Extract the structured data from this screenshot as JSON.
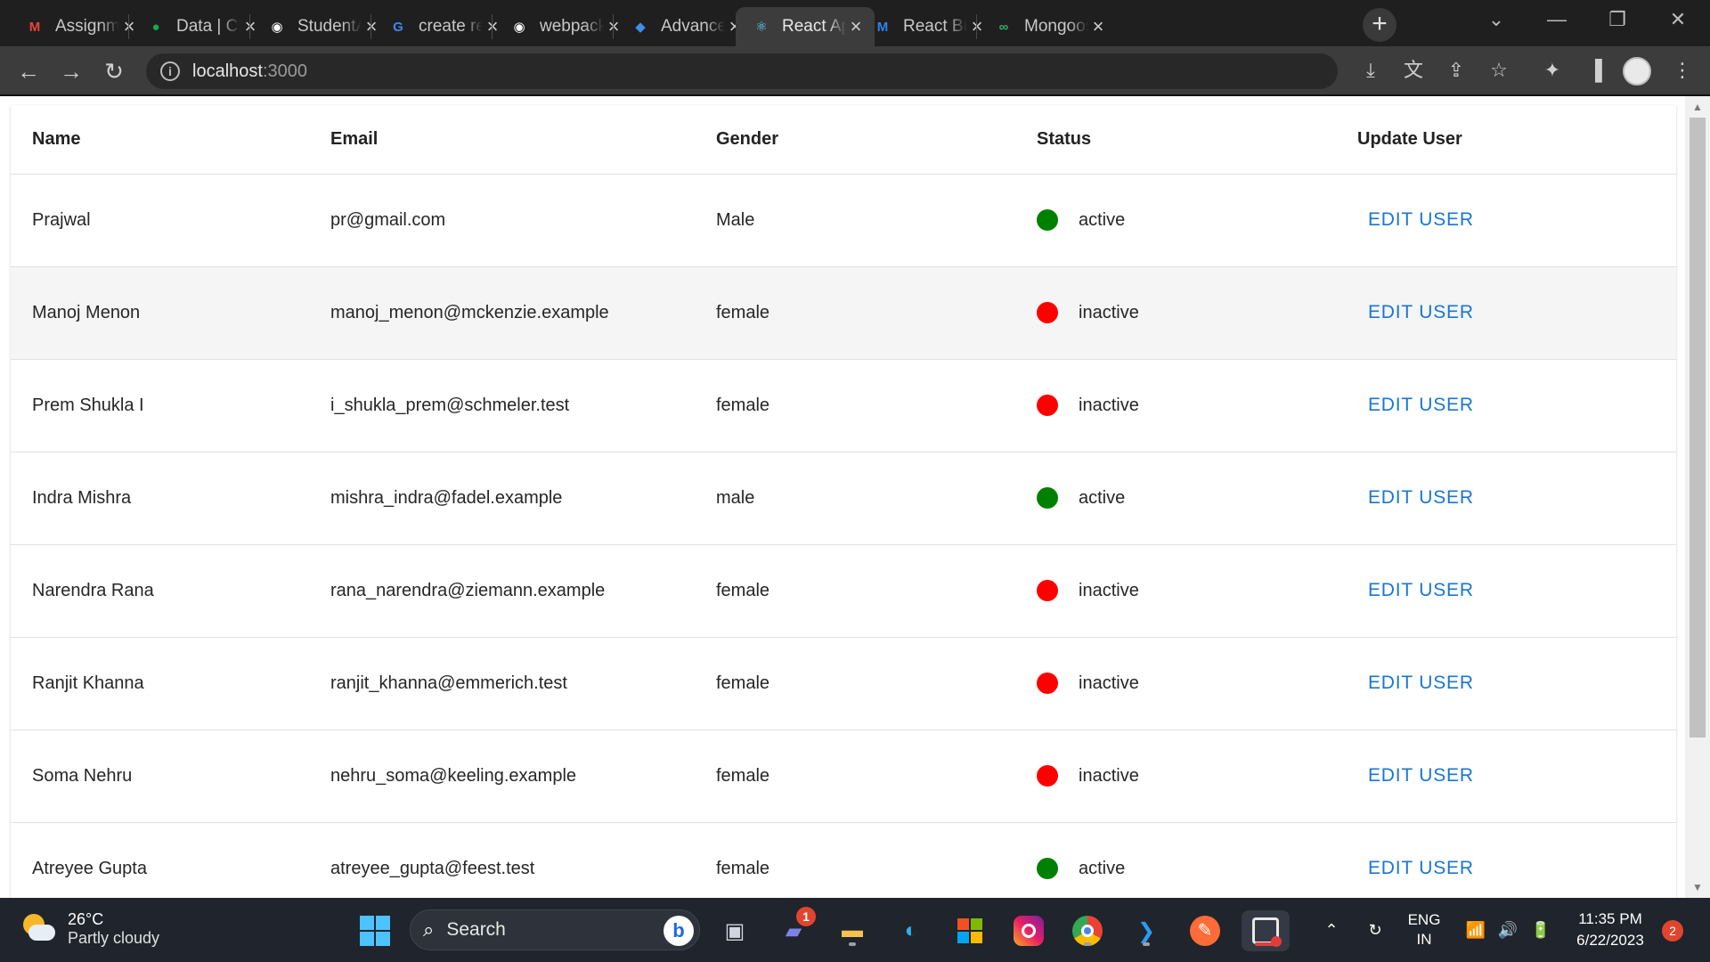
{
  "browser": {
    "tabs": [
      {
        "title": "Assignment",
        "icon": "gmail-icon",
        "icon_char": "M",
        "icon_color": "#ea4335",
        "active": false
      },
      {
        "title": "Data | Cloud",
        "icon": "mongodb-leaf-icon",
        "icon_char": "●",
        "icon_color": "#13aa52",
        "active": false
      },
      {
        "title": "StudentApp",
        "icon": "github-icon",
        "icon_char": "◉",
        "icon_color": "#ffffff",
        "active": false
      },
      {
        "title": "create react",
        "icon": "google-icon",
        "icon_char": "G",
        "icon_color": "#4285f4",
        "active": false
      },
      {
        "title": "webpack",
        "icon": "github-icon",
        "icon_char": "◉",
        "icon_color": "#ffffff",
        "active": false
      },
      {
        "title": "Advanced",
        "icon": "visual-studio-icon",
        "icon_char": "◆",
        "icon_color": "#3d8fe8",
        "active": false
      },
      {
        "title": "React App",
        "icon": "react-icon",
        "icon_char": "⚛",
        "icon_color": "#61dafb",
        "active": true
      },
      {
        "title": "React Bundle",
        "icon": "mui-icon",
        "icon_char": "M",
        "icon_color": "#2f80ed",
        "active": false
      },
      {
        "title": "Mongoose",
        "icon": "mongoose-icon",
        "icon_char": "∞",
        "icon_color": "#2eae6a",
        "active": false
      }
    ],
    "url_host": "localhost",
    "url_port": ":3000"
  },
  "table": {
    "headers": {
      "name": "Name",
      "email": "Email",
      "gender": "Gender",
      "status": "Status",
      "update": "Update User"
    },
    "edit_label": "EDIT USER",
    "rows": [
      {
        "name": "Prajwal",
        "email": "pr@gmail.com",
        "gender": "Male",
        "status": "active"
      },
      {
        "name": "Manoj Menon",
        "email": "manoj_menon@mckenzie.example",
        "gender": "female",
        "status": "inactive"
      },
      {
        "name": "Prem Shukla I",
        "email": "i_shukla_prem@schmeler.test",
        "gender": "female",
        "status": "inactive"
      },
      {
        "name": "Indra Mishra",
        "email": "mishra_indra@fadel.example",
        "gender": "male",
        "status": "active"
      },
      {
        "name": "Narendra Rana",
        "email": "rana_narendra@ziemann.example",
        "gender": "female",
        "status": "inactive"
      },
      {
        "name": "Ranjit Khanna",
        "email": "ranjit_khanna@emmerich.test",
        "gender": "female",
        "status": "inactive"
      },
      {
        "name": "Soma Nehru",
        "email": "nehru_soma@keeling.example",
        "gender": "female",
        "status": "inactive"
      },
      {
        "name": "Atreyee Gupta",
        "email": "atreyee_gupta@feest.test",
        "gender": "female",
        "status": "active"
      }
    ]
  },
  "colors": {
    "active": "#008000",
    "inactive": "#ff0000",
    "link": "#1976d2"
  },
  "taskbar": {
    "temperature": "26°C",
    "weather": "Partly cloudy",
    "search_label": "Search",
    "teams_badge": "1",
    "language": "ENG",
    "region": "IN",
    "time": "11:35 PM",
    "date": "6/22/2023",
    "notification_count": "2"
  }
}
